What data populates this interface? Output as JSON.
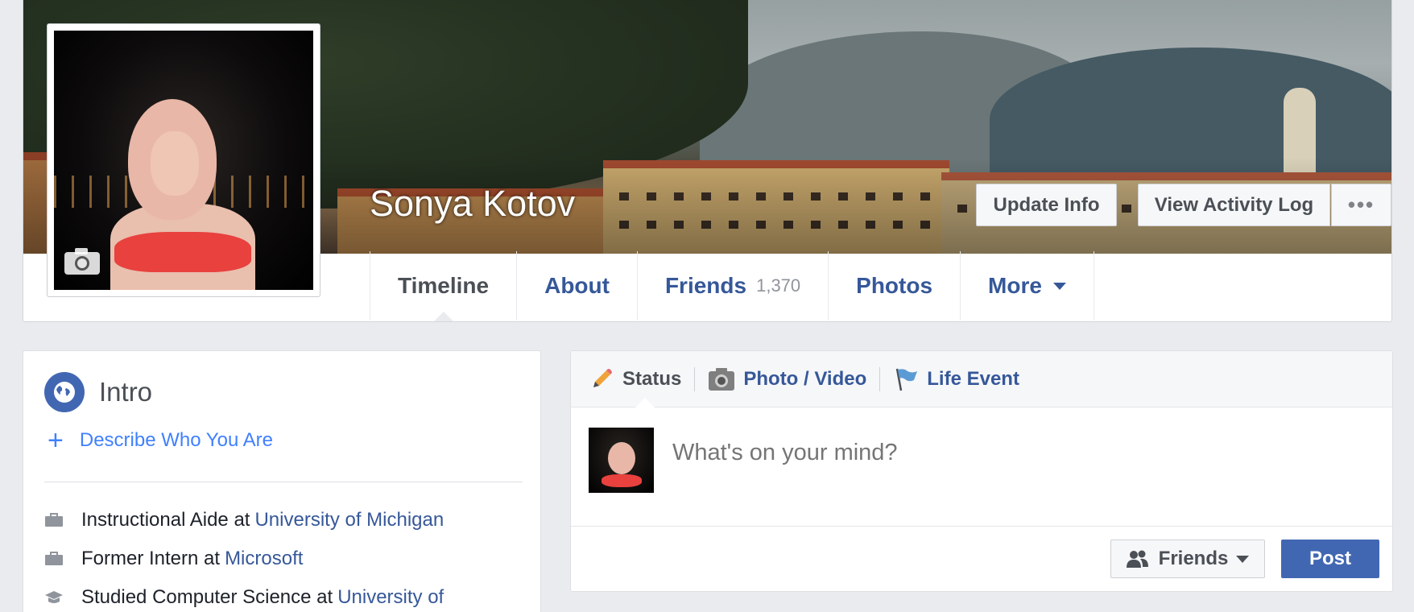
{
  "profile": {
    "name": "Sonya Kotov"
  },
  "cover_actions": {
    "update_info": "Update Info",
    "view_activity_log": "View Activity Log",
    "more_dots": "•••"
  },
  "tabs": [
    {
      "label": "Timeline",
      "active": true
    },
    {
      "label": "About"
    },
    {
      "label": "Friends",
      "count": "1,370"
    },
    {
      "label": "Photos"
    },
    {
      "label": "More"
    }
  ],
  "intro": {
    "title": "Intro",
    "describe_link": "Describe Who You Are",
    "items": [
      {
        "icon": "briefcase-icon",
        "text": "Instructional Aide at",
        "link": "University of Michigan"
      },
      {
        "icon": "briefcase-icon",
        "text": "Former Intern at",
        "link": "Microsoft"
      },
      {
        "icon": "graduation-cap-icon",
        "text": "Studied Computer Science at",
        "link": "University of"
      }
    ]
  },
  "composer": {
    "tabs": [
      {
        "label": "Status",
        "icon": "pencil-icon",
        "active": true
      },
      {
        "label": "Photo / Video",
        "icon": "camera-icon"
      },
      {
        "label": "Life Event",
        "icon": "flag-icon"
      }
    ],
    "placeholder": "What's on your mind?",
    "audience": "Friends",
    "post_label": "Post"
  },
  "colors": {
    "brand_blue": "#4267b2",
    "link_blue": "#365899",
    "accent_blue": "#4080ff",
    "page_bg": "#e9ebee"
  }
}
